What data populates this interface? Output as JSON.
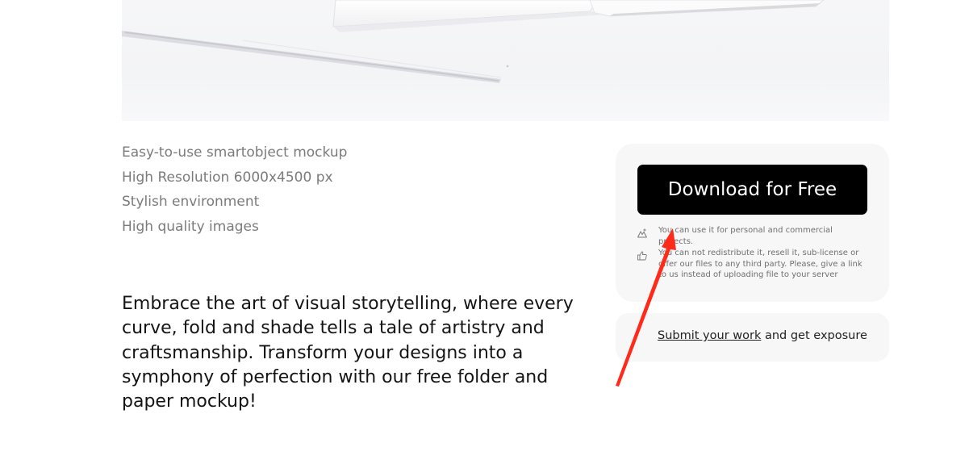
{
  "features": [
    "Easy-to-use smartobject mockup",
    "High Resolution 6000x4500 px",
    "Stylish environment",
    "High quality images"
  ],
  "description": "Embrace the art of visual storytelling, where every curve, fold and shade tells a tale of artistry and craftsmanship. Transform your designs into a symphony of perfection with our free folder and paper mockup!",
  "download": {
    "button_label": "Download for Free",
    "license": [
      {
        "icon": "mountain-icon",
        "text": "You can use it for personal and commercial projects."
      },
      {
        "icon": "thumbs-up-icon",
        "text": "You can not redistribute it, resell it, sub-license or offer our files to any third party. Please, give a link to us instead of uploading file to your server"
      }
    ]
  },
  "submit": {
    "link_text": "Submit your work",
    "rest_text": " and get exposure"
  },
  "colors": {
    "button_bg": "#000000",
    "card_bg": "#f6f7f6",
    "annotation_arrow": "#ff2a1a"
  }
}
